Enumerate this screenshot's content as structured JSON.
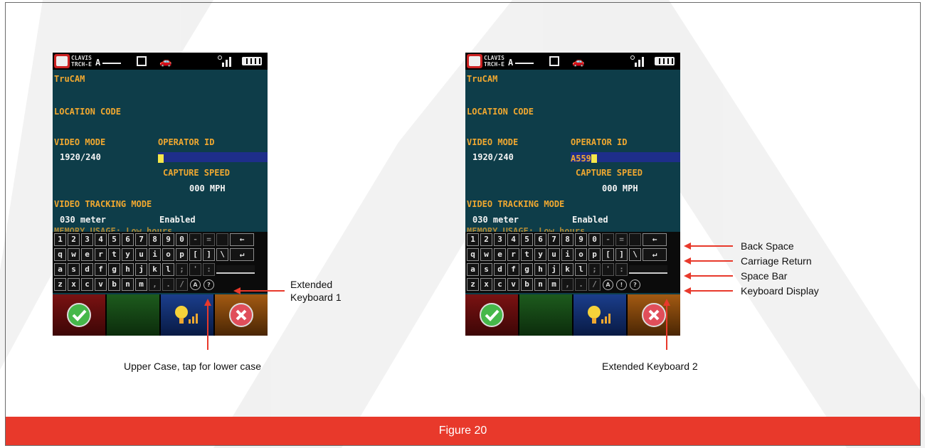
{
  "caption": "Figure 20",
  "device": {
    "status": {
      "badge_text": "CLAVIS\nTRCH-E",
      "gate": "A"
    },
    "app_name": "TruCAM",
    "location_code_label": "LOCATION CODE",
    "video_mode_label": "VIDEO MODE",
    "video_mode_value": "1920/240",
    "operator_id_label": "OPERATOR ID",
    "capture_speed_label": "CAPTURE SPEED",
    "capture_speed_value": "000 MPH",
    "video_tracking_label": "VIDEO TRACKING MODE",
    "tracking_distance": "030 meter",
    "tracking_state": "Enabled",
    "memory_usage_partial": "MEMORY USAGE: Low hours"
  },
  "screens": {
    "left": {
      "operator_id_value": ""
    },
    "right": {
      "operator_id_value": "A559"
    }
  },
  "keyboard": {
    "row1": [
      "1",
      "2",
      "3",
      "4",
      "5",
      "6",
      "7",
      "8",
      "9",
      "0",
      "-",
      "=",
      "",
      "←"
    ],
    "row2": [
      "q",
      "w",
      "e",
      "r",
      "t",
      "y",
      "u",
      "i",
      "o",
      "p",
      "[",
      "]",
      "\\",
      "↵"
    ],
    "row3": [
      "a",
      "s",
      "d",
      "f",
      "g",
      "h",
      "j",
      "k",
      "l",
      ";",
      "'",
      ":",
      ""
    ],
    "row4": [
      "z",
      "x",
      "c",
      "v",
      "b",
      "n",
      "m",
      ",",
      ".",
      "/"
    ],
    "row4_circles_left": [
      "A",
      "?"
    ],
    "row4_circles_right": [
      "A",
      "!",
      "?"
    ]
  },
  "callouts": {
    "extended_keyboard_1": "Extended\nKeyboard 1",
    "upper_case": "Upper Case, tap for lower case",
    "back_space": "Back Space",
    "carriage_return": "Carriage Return",
    "space_bar": "Space Bar",
    "keyboard_display": "Keyboard Display",
    "extended_keyboard_2": "Extended Keyboard 2"
  },
  "colors": {
    "caption_bar": "#e8392b",
    "arrow": "#e8392b",
    "screen_bg": "#0e3d49",
    "label_orange": "#f0a830"
  }
}
